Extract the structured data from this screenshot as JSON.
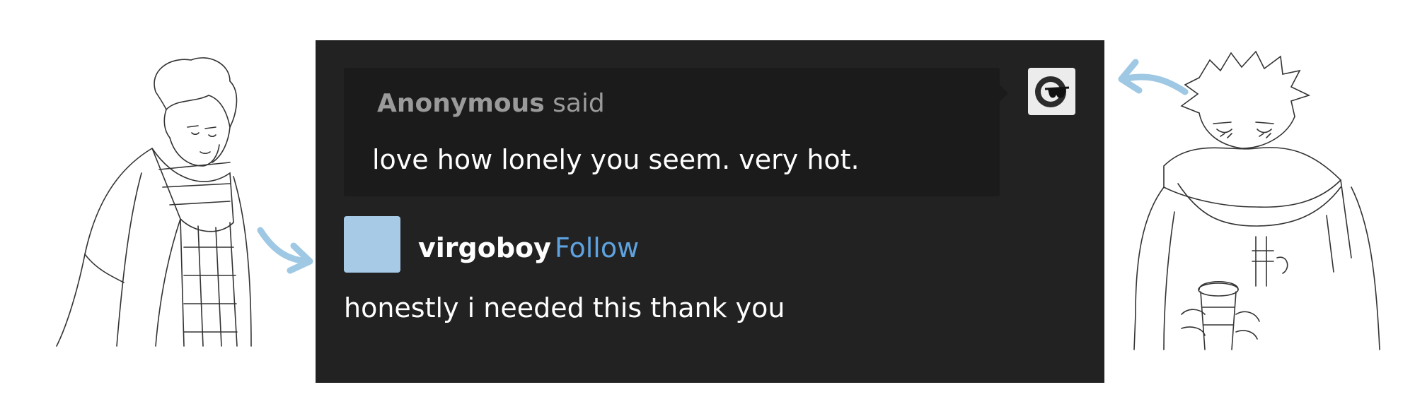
{
  "ask": {
    "asker_name": "Anonymous",
    "said_label": "said",
    "question": "love how lonely you seem. very hot."
  },
  "answer": {
    "username": "virgoboy",
    "follow_label": "Follow",
    "text": "honestly i needed this thank you",
    "avatar_color": "#a7cbe6"
  },
  "theme": {
    "panel_bg": "#222222",
    "bubble_bg": "#1b1b1b",
    "follow_color": "#5ea2df",
    "arrow_color": "#9ec8e3"
  },
  "icons": {
    "anon_avatar": "sunglasses-anonymous-icon"
  }
}
